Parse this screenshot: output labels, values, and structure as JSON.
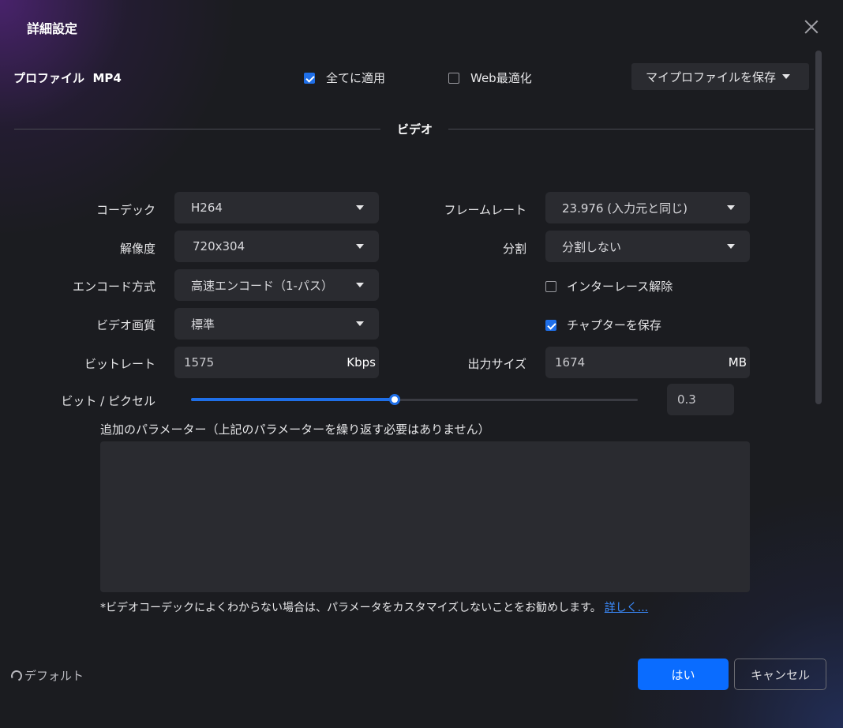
{
  "window": {
    "title": "詳細設定"
  },
  "profile": {
    "label": "プロファイル",
    "format": "MP4",
    "apply_all": {
      "label": "全てに適用",
      "checked": true
    },
    "web_optimize": {
      "label": "Web最適化",
      "checked": false
    },
    "save_profile_label": "マイプロファイルを保存"
  },
  "section": {
    "title": "ビデオ"
  },
  "video": {
    "codec": {
      "label": "コーデック",
      "value": "H264"
    },
    "resolution": {
      "label": "解像度",
      "value": "720x304"
    },
    "encode_mode": {
      "label": "エンコード方式",
      "value": "高速エンコード（1-パス）"
    },
    "quality": {
      "label": "ビデオ画質",
      "value": "標準"
    },
    "bitrate": {
      "label": "ビットレート",
      "value": "1575",
      "unit": "Kbps"
    },
    "framerate": {
      "label": "フレームレート",
      "value": "23.976 (入力元と同じ)"
    },
    "split": {
      "label": "分割",
      "value": "分割しない"
    },
    "deinterlace": {
      "label": "インターレース解除",
      "checked": false
    },
    "save_chapters": {
      "label": "チャプターを保存",
      "checked": true
    },
    "output_size": {
      "label": "出力サイズ",
      "value": "1674",
      "unit": "MB"
    },
    "bits_per_pixel": {
      "label": "ビット / ピクセル",
      "value": "0.3",
      "slider_fraction": 0.455
    }
  },
  "params": {
    "label": "追加のパラメーター（上記のパラメーターを繰り返す必要はありません）",
    "value": ""
  },
  "note": {
    "text": "*ビデオコーデックによくわからない場合は、パラメータをカスタマイズしないことをお勧めします。",
    "link": "詳しく..."
  },
  "footer": {
    "default_label": "デフォルト",
    "ok_label": "はい",
    "cancel_label": "キャンセル"
  },
  "colors": {
    "accent": "#1f6fe8",
    "primary_button": "#0a6cff",
    "link": "#3b8cff",
    "background": "#1b1c20",
    "field": "#2a2b30"
  }
}
